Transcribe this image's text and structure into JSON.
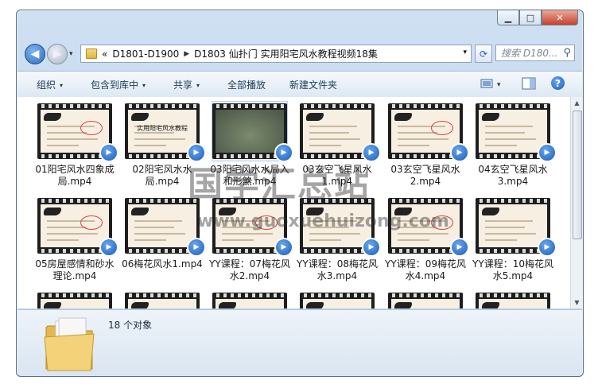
{
  "window": {
    "caption_min": "▁",
    "caption_max": "□",
    "caption_close": "✕"
  },
  "nav": {
    "back_icon": "back-arrow-icon",
    "back_glyph": "◀",
    "forward_glyph": "▶",
    "history_glyph": "▾",
    "address": {
      "prefix": "«",
      "crumb1": "D1801-D1900",
      "sep": "▶",
      "crumb2": "D1803 仙扑门 实用阳宅风水教程视频18集",
      "dropdown": "▾"
    },
    "refresh_glyph": "⟳",
    "search_placeholder": "搜索 D180...",
    "search_glyph": "⚲"
  },
  "toolbar": {
    "organize": "组织",
    "include_library": "包含到库中",
    "share": "共享",
    "play_all": "全部播放",
    "new_folder": "新建文件夹",
    "dd": "▾",
    "view_dd": "▾",
    "help": "?"
  },
  "files": [
    {
      "label": "01阳宅风水四象成局.mp4"
    },
    {
      "label": "02阳宅风水水局.mp4"
    },
    {
      "label": "03阳宅风水水局入和形煞.mp4"
    },
    {
      "label": "03玄空飞星风水1.mp4"
    },
    {
      "label": "03玄空飞星风水2.mp4"
    },
    {
      "label": "04玄空飞星风水3.mp4"
    },
    {
      "label": "05房屋感情和砂水理论.mp4"
    },
    {
      "label": "06梅花风水1.mp4"
    },
    {
      "label": "YY课程：07梅花风水2.mp4"
    },
    {
      "label": "YY课程：08梅花风水3.mp4"
    },
    {
      "label": "YY课程：09梅花风水4.mp4"
    },
    {
      "label": "YY课程：10梅花风水5.mp4"
    }
  ],
  "thumb_title_02": "实用阳宅风水教程",
  "status": {
    "count": "18 个对象"
  },
  "watermark": {
    "line1": "国学汇总站",
    "line2": "www.guoxuehuizong.com"
  },
  "scroll": {
    "up": "▲",
    "down": "▼"
  }
}
